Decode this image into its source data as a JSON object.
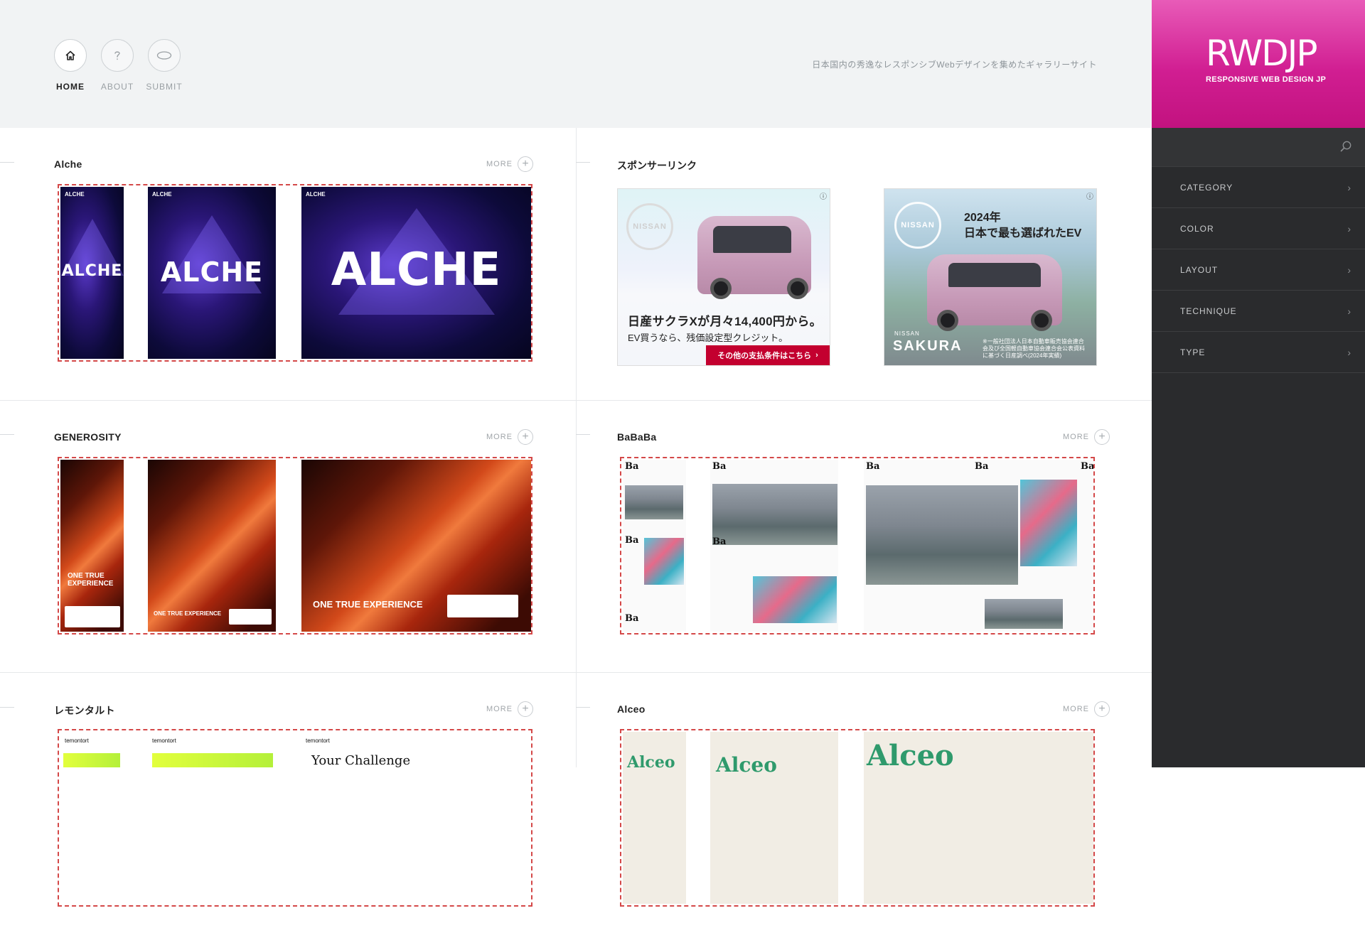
{
  "header": {
    "nav": [
      {
        "label": "HOME",
        "icon": "home-icon",
        "active": true
      },
      {
        "label": "ABOUT",
        "icon": "question-icon",
        "active": false
      },
      {
        "label": "SUBMIT",
        "icon": "speech-bubble-icon",
        "active": false
      }
    ],
    "tagline": "日本国内の秀逸なレスポンシブWebデザインを集めたギャラリーサイト"
  },
  "sidebar": {
    "logo": "RWDJP",
    "logo_sub": "RESPONSIVE WEB DESIGN JP",
    "menu": [
      {
        "label": "CATEGORY"
      },
      {
        "label": "COLOR"
      },
      {
        "label": "LAYOUT"
      },
      {
        "label": "TECHNIQUE"
      },
      {
        "label": "TYPE"
      }
    ],
    "colors": {
      "accent": "#d11e92",
      "background": "#2a2b2d"
    }
  },
  "gallery": {
    "more_label": "MORE",
    "items": [
      {
        "title": "Alche"
      },
      {
        "title": "GENEROSITY"
      },
      {
        "title": "BaBaBa"
      },
      {
        "title": "レモンタルト"
      },
      {
        "title": "Alceo"
      }
    ]
  },
  "ads": {
    "title": "スポンサーリンク",
    "ad1": {
      "brand": "NISSAN",
      "copy": "日産サクラXが月々14,400円から。",
      "sub": "EV買うなら、残価設定型クレジット。",
      "cta": "その他の支払条件はこちら"
    },
    "ad2": {
      "brand": "NISSAN",
      "year": "2024年",
      "copy": "日本で最も選ばれたEV",
      "model_small": "NISSAN",
      "model": "SAKURA",
      "note": "※一般社団法人日本自動車販売協会連合会及び全国軽自動車協会連合会公表資料に基づく日産調べ(2024年実績)"
    }
  },
  "thumbs": {
    "alche": "ALCHE",
    "alche_mark": "ALCHE",
    "generosity": "ONE TRUE EXPERIENCE",
    "generosity_split": "ONE TRUE\nEXPERIENCE",
    "bababa": "Ba",
    "temontort": "temontort",
    "temontort_hero": "Your Challenge",
    "alceo": "Alceo"
  }
}
